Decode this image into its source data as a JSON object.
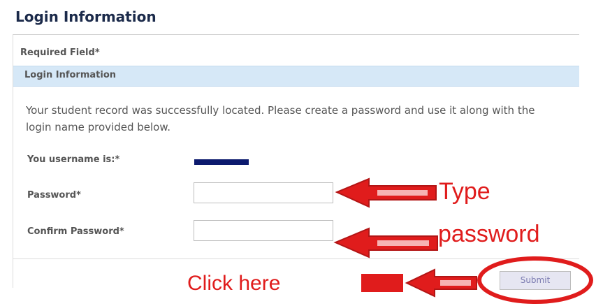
{
  "page": {
    "title": "Login Information"
  },
  "form": {
    "required_label": "Required Field*",
    "section_title": "Login Information",
    "message": "Your student record was successfully located. Please create a password and use it along with the login name provided below.",
    "username_label": "You username is:*",
    "password_label": "Password*",
    "password_value": "",
    "confirm_label": "Confirm Password*",
    "confirm_value": "",
    "submit_label": "Submit"
  },
  "annotations": {
    "type_text": "Type",
    "password_text": "password",
    "click_text": "Click here",
    "arrow_color": "#e01c1c"
  },
  "colors": {
    "section_bar": "#d6e8f7",
    "username_redaction": "#0c1a6e"
  }
}
